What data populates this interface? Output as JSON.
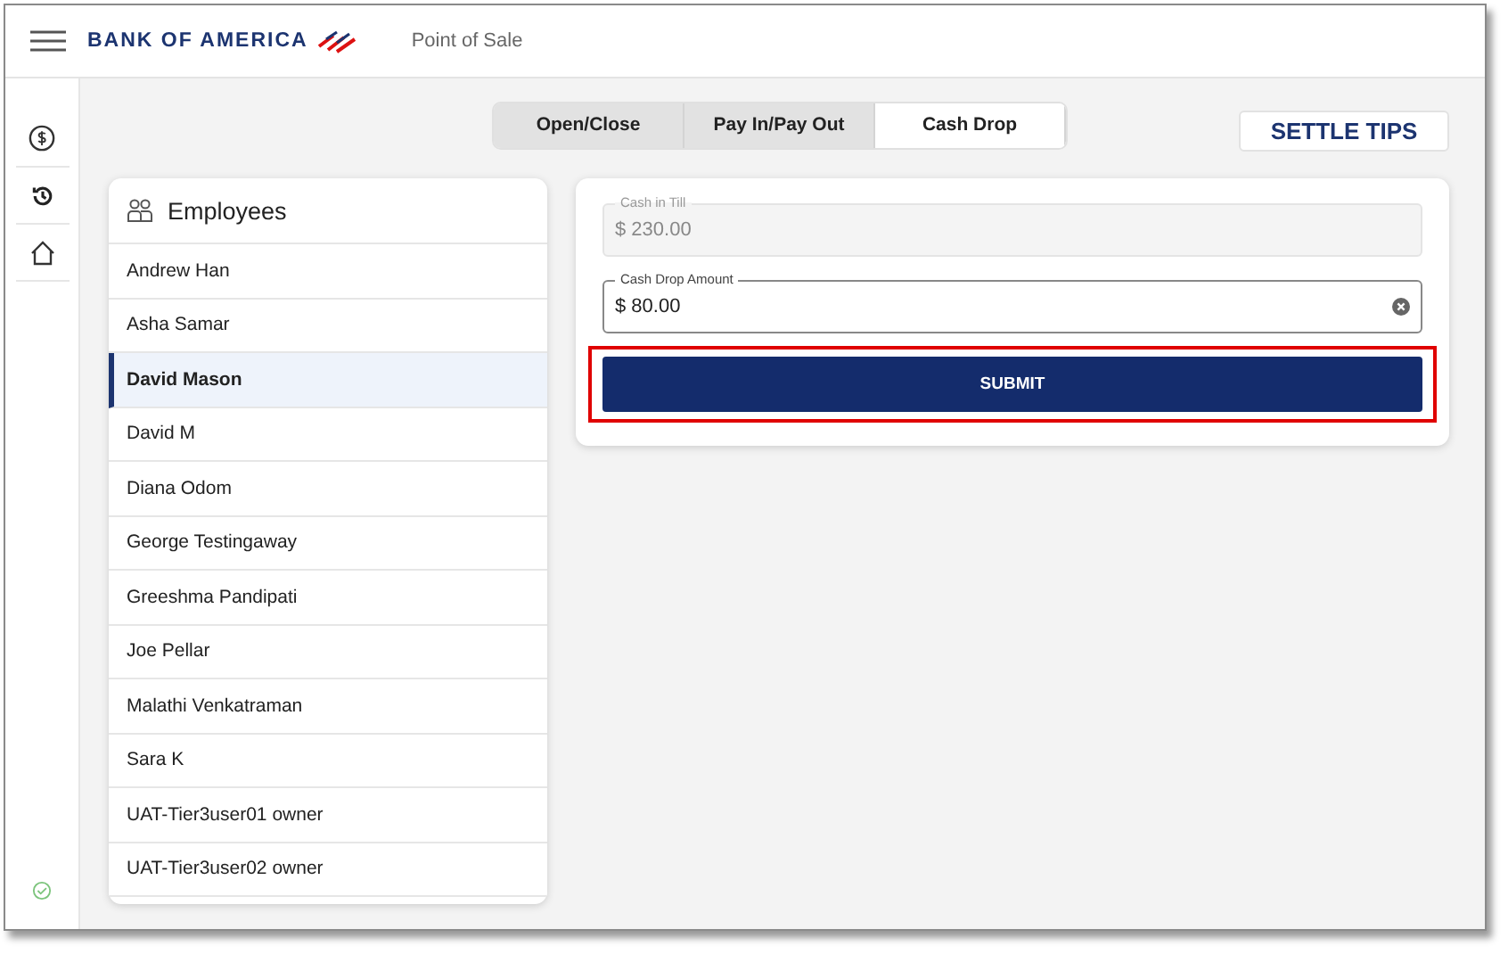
{
  "header": {
    "brand": "BANK OF AMERICA",
    "app_name": "Point of Sale"
  },
  "sidebar": {
    "items": [
      {
        "kind": "dollar",
        "selected": false
      },
      {
        "kind": "history",
        "selected": false
      },
      {
        "kind": "home",
        "selected": false
      }
    ],
    "status_ok": true
  },
  "tabs": [
    {
      "label": "Open/Close",
      "selected": false
    },
    {
      "label": "Pay In/Pay Out",
      "selected": false
    },
    {
      "label": "Cash Drop",
      "selected": true
    }
  ],
  "settle_tips": "SETTLE TIPS",
  "employees": {
    "title": "Employees",
    "items": [
      {
        "name": "Andrew Han",
        "selected": false
      },
      {
        "name": "Asha Samar",
        "selected": false
      },
      {
        "name": "David Mason",
        "selected": true
      },
      {
        "name": "David M",
        "selected": false
      },
      {
        "name": "Diana Odom",
        "selected": false
      },
      {
        "name": "George Testingaway",
        "selected": false
      },
      {
        "name": "Greeshma Pandipati",
        "selected": false
      },
      {
        "name": "Joe Pellar",
        "selected": false
      },
      {
        "name": "Malathi Venkatraman",
        "selected": false
      },
      {
        "name": "Sara K",
        "selected": false
      },
      {
        "name": "UAT-Tier3user01 owner",
        "selected": false
      },
      {
        "name": "UAT-Tier3user02 owner",
        "selected": false
      }
    ]
  },
  "fields": [
    {
      "label": "Cash in Till",
      "value": "$ 230.00",
      "disabled": true
    },
    {
      "label": "Cash Drop Amount",
      "value": "$ 80.00",
      "disabled": false
    }
  ],
  "submit": {
    "label": "SUBMIT",
    "highlighted": true
  }
}
